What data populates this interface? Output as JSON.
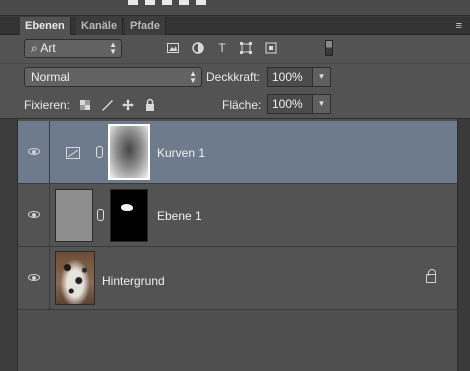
{
  "tabs": [
    {
      "label": "Ebenen",
      "active": true
    },
    {
      "label": "Kanäle",
      "active": false
    },
    {
      "label": "Pfade",
      "active": false
    }
  ],
  "panel_menu_icon": "≡",
  "filter": {
    "kind_label": "Art",
    "search_icon": "⌕",
    "icons": [
      "image-filter-icon",
      "adjustment-filter-icon",
      "type-filter-icon",
      "shape-filter-icon",
      "smart-object-filter-icon"
    ],
    "type_glyph": "T"
  },
  "blend": {
    "mode": "Normal",
    "opacity_label": "Deckkraft:",
    "opacity_value": "100%"
  },
  "locks": {
    "label": "Fixieren:",
    "fill_label": "Fläche:",
    "fill_value": "100%"
  },
  "layers": [
    {
      "name": "Kurven 1",
      "selected": true,
      "type": "adjustment"
    },
    {
      "name": "Ebene 1",
      "selected": false,
      "type": "pixel"
    },
    {
      "name": "Hintergrund",
      "selected": false,
      "type": "background",
      "locked": true
    }
  ],
  "colors": {
    "panel_bg": "#535353",
    "selected_row": "#6e7b8d"
  }
}
